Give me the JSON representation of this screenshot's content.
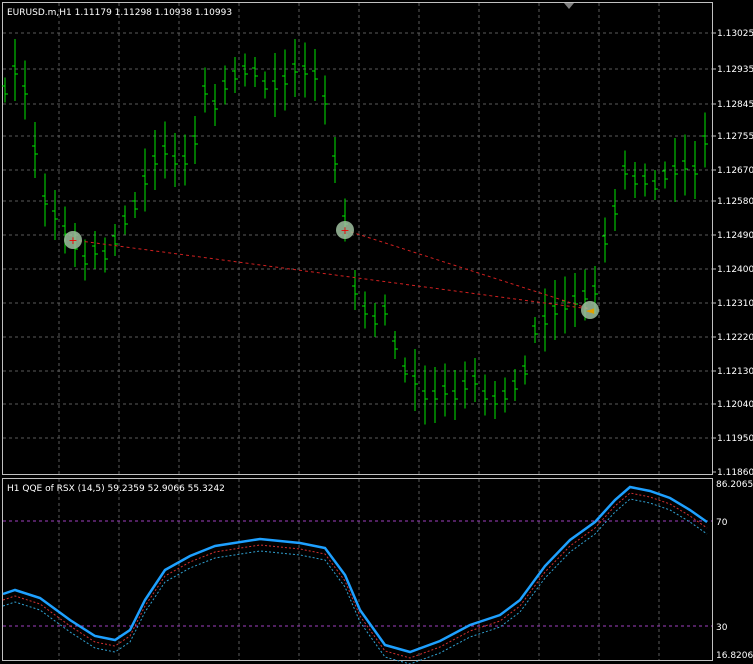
{
  "main_panel": {
    "header": "EURUSD.m,H1  1.11179 1.11298 1.10938 1.10993",
    "price_scale": [
      "1.13025",
      "1.12935",
      "1.12845",
      "1.12755",
      "1.12670",
      "1.12580",
      "1.12490",
      "1.12400",
      "1.12310",
      "1.12220",
      "1.12130",
      "1.12040",
      "1.11950",
      "1.11860"
    ]
  },
  "indicator_panel": {
    "header": "H1 QQE of RSX (14,5) 59.2359 52.9066 55.3242",
    "scale": {
      "top": "86.2065",
      "upper": "70",
      "lower": "30",
      "bottom": "16.8206"
    }
  },
  "colors": {
    "background": "#000000",
    "grid": "#5a5a5a",
    "frame": "#c0c0c0",
    "bars": "#00e600",
    "rsx_line": "#1ea0ff",
    "signal_fast": "#d03030",
    "signal_slow": "#30a0d0",
    "level_lines": "#a040c0",
    "trendline": "#d02020",
    "marker": "#9fbf9f"
  },
  "markers": [
    {
      "name": "buy-marker-1",
      "glyph": "+"
    },
    {
      "name": "buy-marker-2",
      "glyph": "+"
    },
    {
      "name": "sell-marker-3",
      "glyph": "◄"
    }
  ]
}
